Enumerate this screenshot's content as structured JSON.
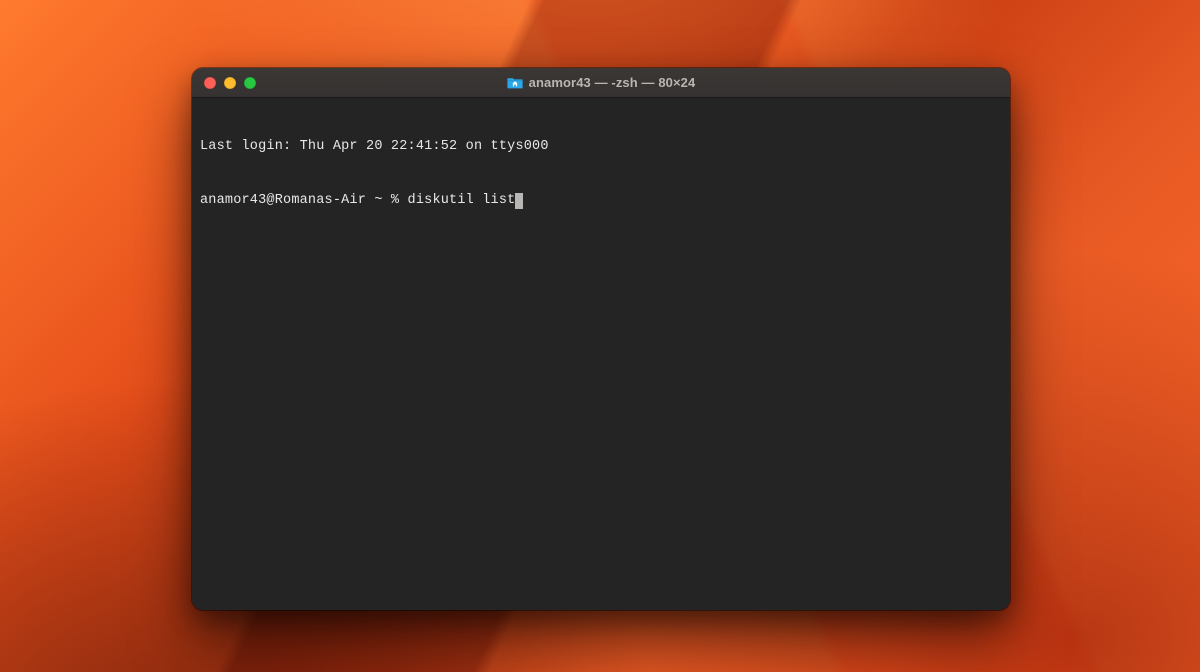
{
  "window": {
    "title": "anamor43 — -zsh — 80×24",
    "icon": "home-folder-icon"
  },
  "terminal": {
    "last_login_line": "Last login: Thu Apr 20 22:41:52 on ttys000",
    "prompt": "anamor43@Romanas-Air ~ % ",
    "command": "diskutil list"
  },
  "colors": {
    "close": "#ff5f57",
    "minimize": "#febc2e",
    "zoom": "#28c840"
  }
}
